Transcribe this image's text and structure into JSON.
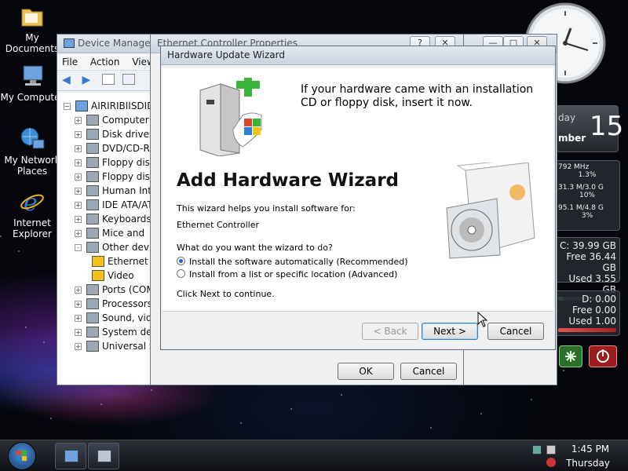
{
  "desktop": {
    "icons": [
      {
        "label": "My Documents"
      },
      {
        "label": "My Computer"
      },
      {
        "label": "My Network Places"
      },
      {
        "label": "Internet Explorer"
      }
    ]
  },
  "device_manager": {
    "title": "Device Manager",
    "menu": [
      "File",
      "Action",
      "View"
    ],
    "root": "AIRIRIBIISDIDI",
    "items": [
      {
        "label": "Computer",
        "exp": "+"
      },
      {
        "label": "Disk drives",
        "exp": "+"
      },
      {
        "label": "DVD/CD-ROM",
        "exp": "+"
      },
      {
        "label": "Floppy disk",
        "exp": "+"
      },
      {
        "label": "Floppy disk",
        "exp": "+"
      },
      {
        "label": "Human Interface",
        "exp": "+"
      },
      {
        "label": "IDE ATA/ATAPI",
        "exp": "+"
      },
      {
        "label": "Keyboards",
        "exp": "+"
      },
      {
        "label": "Mice and",
        "exp": "+"
      },
      {
        "label": "Other devices",
        "exp": "-"
      },
      {
        "label": "Ethernet",
        "child": true
      },
      {
        "label": "Video",
        "child": true
      },
      {
        "label": "Ports (COM",
        "exp": "+"
      },
      {
        "label": "Processors",
        "exp": "+"
      },
      {
        "label": "Sound, video",
        "exp": "+"
      },
      {
        "label": "System devices",
        "exp": "+"
      },
      {
        "label": "Universal Serial",
        "exp": "+"
      }
    ]
  },
  "ethernet_props": {
    "title": "Ethernet Controller Properties",
    "help_label": "?",
    "close_label": "✕",
    "ok_label": "OK",
    "cancel_label": "Cancel"
  },
  "wizard": {
    "title": "Hardware Update Wizard",
    "heading": "If your hardware came with an installation CD or floppy disk, insert it now.",
    "main_title": "Add Hardware Wizard",
    "helps_text": "This wizard helps you install software for:",
    "device_name": "Ethernet Controller",
    "question": "What do you want the wizard to do?",
    "options": [
      {
        "label": "Install the software automatically (Recommended)",
        "selected": true
      },
      {
        "label": "Install from a list or specific location (Advanced)",
        "selected": false
      }
    ],
    "continue_text": "Click Next to continue.",
    "back_label": "< Back",
    "next_label": "Next >",
    "cancel_label": "Cancel"
  },
  "gadgets": {
    "calendar": {
      "day_name": "day",
      "month": "mber",
      "day": "15"
    },
    "cpu": {
      "freq": "792 MHz",
      "pct1": "1.3%",
      "mem": "31.3 M/3.0 G",
      "pct2": "10%",
      "mem2": "95.1 M/4.8 G",
      "pct3": "3%"
    },
    "drive_c": {
      "label": "C:",
      "total": "39.99 GB",
      "free_label": "Free",
      "free": "36.44 GB",
      "used_label": "Used",
      "used": "3.55 GB",
      "used_fraction": 0.09
    },
    "drive_d": {
      "label": "D:",
      "total": "0.00",
      "free_label": "Free",
      "free": "0.00",
      "used_label": "Used",
      "used": "1.00",
      "used_fraction": 1.0
    }
  },
  "taskbar": {
    "time": "1:45 PM",
    "day": "Thursday"
  }
}
